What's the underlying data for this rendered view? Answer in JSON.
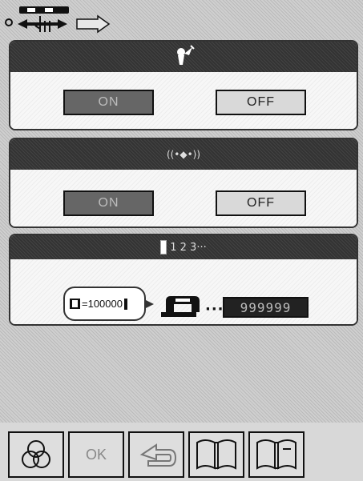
{
  "panels": {
    "panel1": {
      "header_icon": "fairy-icon",
      "on_label": "ON",
      "off_label": "OFF"
    },
    "panel2": {
      "header_label": "((•◆•))",
      "on_label": "ON",
      "off_label": "OFF"
    },
    "panel3": {
      "header_label": "1 2 3···",
      "counter_text": "=100000",
      "dots_text": "···",
      "display_value": "999999"
    }
  },
  "bottom_bar": {
    "ok_label": "OK",
    "icons": [
      "three-circles-icon",
      "ok-icon",
      "back-arrow-icon",
      "book-icon",
      "book-icon"
    ]
  }
}
